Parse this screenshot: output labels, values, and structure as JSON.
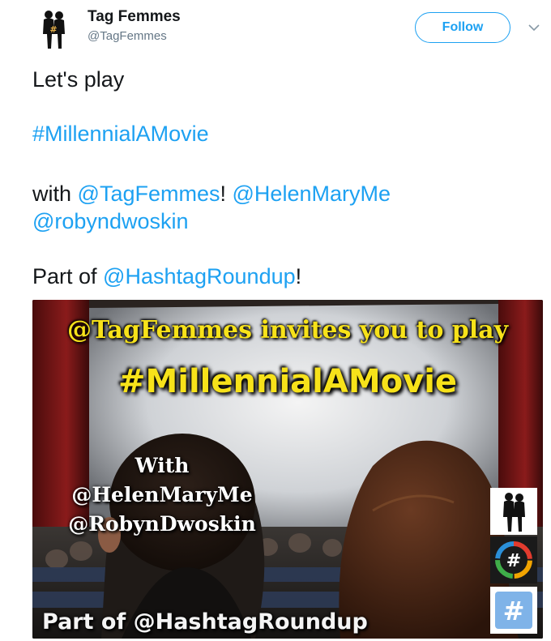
{
  "account": {
    "name": "Tag Femmes",
    "handle": "@TagFemmes",
    "follow_label": "Follow"
  },
  "tweet": {
    "line1": "Let's play",
    "hashtag": "#MillennialAMovie",
    "with_text": "with ",
    "mention_tagfemmes": "@TagFemmes",
    "exclaim1": "!",
    "mention_helen": "@HelenMaryMe",
    "mention_robyn": "@robyndwoskin",
    "part_of": "Part of ",
    "mention_roundup": "@HashtagRoundup",
    "exclaim2": "!"
  },
  "media": {
    "caption_top": "@TagFemmes invites you to play",
    "caption_hashtag": "#MillennialAMovie",
    "caption_with": "With",
    "caption_helen": "@HelenMaryMe",
    "caption_robyn": "@RobynDwoskin",
    "caption_bottom": "Part of @HashtagRoundup",
    "badge_hash_1": "#",
    "badge_hash_2": "#"
  },
  "icons": {
    "avatar": "tag-femmes-logo",
    "menu": "chevron-down-icon"
  },
  "colors": {
    "link": "#1da1f2",
    "caption_yellow": "#f7e21a"
  }
}
